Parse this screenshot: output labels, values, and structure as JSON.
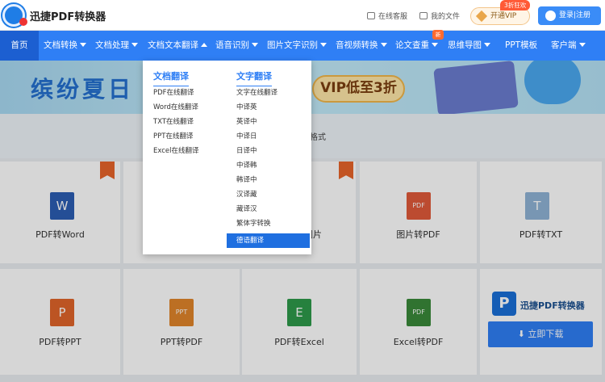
{
  "header": {
    "brand": "迅捷PDF转换器",
    "service": "在线客服",
    "files": "我的文件",
    "vip": "开通VIP",
    "vip_badge": "3折狂欢",
    "login": "登录|注册"
  },
  "nav": {
    "items": [
      {
        "label": "首页"
      },
      {
        "label": "文档转换"
      },
      {
        "label": "文档处理"
      },
      {
        "label": "文档文本翻译"
      },
      {
        "label": "语音识别"
      },
      {
        "label": "图片文字识别"
      },
      {
        "label": "音视频转换"
      },
      {
        "label": "论文查重"
      },
      {
        "label": "思维导图"
      },
      {
        "label": "PPT模板"
      },
      {
        "label": "客户端"
      }
    ],
    "new_badge": "新"
  },
  "banner": {
    "title": "缤纷夏日",
    "sale": "VIP低至3折"
  },
  "strip_text": "格式",
  "dropdown": {
    "col1": {
      "title": "文档翻译",
      "items": [
        "PDF在线翻译",
        "Word在线翻译",
        "TXT在线翻译",
        "PPT在线翻译",
        "Excel在线翻译"
      ]
    },
    "col2": {
      "title": "文字翻译",
      "items": [
        "文字在线翻译",
        "中译英",
        "英译中",
        "中译日",
        "日译中",
        "中译韩",
        "韩译中",
        "汉译藏",
        "藏译汉",
        "繁体字转换",
        "德语翻译"
      ]
    }
  },
  "tools": {
    "row1": [
      {
        "label": "PDF转Word",
        "icon": "W",
        "color": "#2b5eb3"
      },
      {
        "label": "图片",
        "icon": "",
        "color": "#999999"
      },
      {
        "label": "图片转PDF",
        "icon": "PDF",
        "color": "#e05a3a"
      },
      {
        "label": "PDF转TXT",
        "icon": "T",
        "color": "#8fb3d6"
      }
    ],
    "row2": [
      {
        "label": "PDF转PPT",
        "icon": "P",
        "color": "#e0652a"
      },
      {
        "label": "PPT转PDF",
        "icon": "PPT",
        "color": "#e0852a"
      },
      {
        "label": "PDF转Excel",
        "icon": "E",
        "color": "#2e9a4a"
      },
      {
        "label": "Excel转PDF",
        "icon": "PDF",
        "color": "#3a8a3a"
      }
    ]
  },
  "promo": {
    "name": "迅捷PDF转换器",
    "download": "立即下载"
  }
}
